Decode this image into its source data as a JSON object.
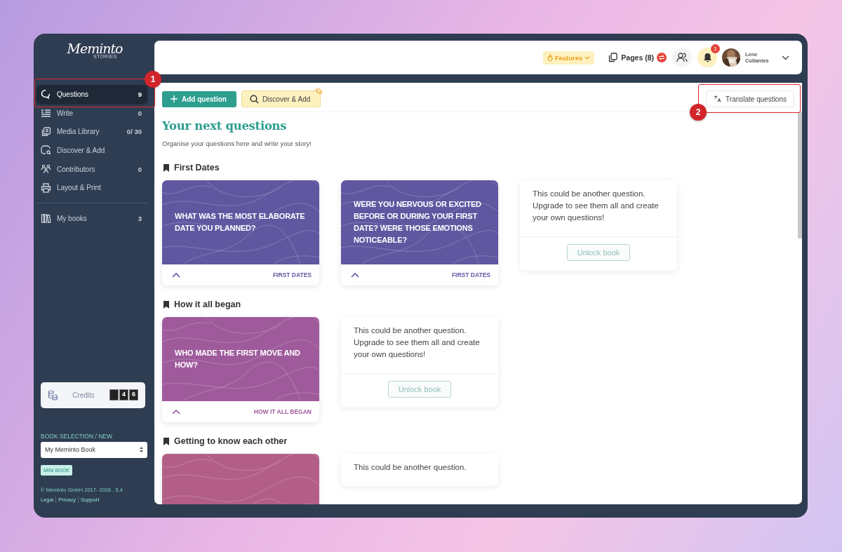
{
  "sidebar": {
    "logo": {
      "name": "Meminto",
      "tagline": "STORIES"
    },
    "items": [
      {
        "label": "Questions",
        "count": "9",
        "selected": true
      },
      {
        "label": "Write",
        "count": "0",
        "selected": false
      },
      {
        "label": "Media Library",
        "count": "0/ 30",
        "selected": false
      },
      {
        "label": "Discover & Add",
        "selected": false
      },
      {
        "label": "Contributors",
        "count": "0",
        "selected": false
      },
      {
        "label": "Layout & Print",
        "selected": false
      }
    ],
    "books": {
      "label": "My books",
      "count": "3",
      "selected": false
    },
    "credits": {
      "label": "Credits",
      "digits": [
        "4",
        "6"
      ]
    },
    "book_selection": {
      "heading": "BOOK SELECTION / NEW",
      "value": "My Meminto Book",
      "tag": "MINI BOOK"
    },
    "footer": {
      "copyright": "© Meminto GmbH 2017- 2026 , 5.4",
      "links": [
        "Legal",
        "Privacy",
        "Support"
      ]
    }
  },
  "topbar": {
    "features": "Features",
    "pages": "Pages (8)",
    "notifications": "1",
    "user": {
      "first_name": "Lene",
      "last_name": "Collantes"
    }
  },
  "toolbar": {
    "add": "Add question",
    "discover": "Discover & Add",
    "translate": "Translate questions"
  },
  "heading": "Your next questions",
  "subheading": "Organise your questions here and write your story!",
  "sections": [
    {
      "title": "First Dates",
      "cards": [
        {
          "kind": "question",
          "text": "WHAT WAS THE MOST ELABORATE DATE YOU PLANNED?",
          "tag": "FIRST DATES",
          "color": "#5f57a0"
        },
        {
          "kind": "question",
          "text": "WERE YOU NERVOUS OR EXCITED BEFORE OR DURING YOUR FIRST DATE? WERE THOSE EMOTIONS NOTICEABLE?",
          "tag": "FIRST DATES",
          "color": "#5f57a0"
        },
        {
          "kind": "locked",
          "text": "This could be another question. Upgrade to see them all and create your own questions!",
          "button": "Unlock book"
        }
      ]
    },
    {
      "title": "How it all began",
      "cards": [
        {
          "kind": "question",
          "text": "WHO MADE THE FIRST MOVE AND HOW?",
          "tag": "HOW IT ALL BEGAN",
          "color": "#9f5a9c"
        },
        {
          "kind": "locked",
          "text": "This could be another question. Upgrade to see them all and create your own questions!",
          "button": "Unlock book"
        }
      ]
    },
    {
      "title": "Getting to know each other",
      "cards": [
        {
          "kind": "question",
          "color": "#b35e86"
        },
        {
          "kind": "locked",
          "text": "This could be another question."
        }
      ]
    }
  ],
  "annotations": [
    {
      "label": "1"
    },
    {
      "label": "2"
    }
  ]
}
